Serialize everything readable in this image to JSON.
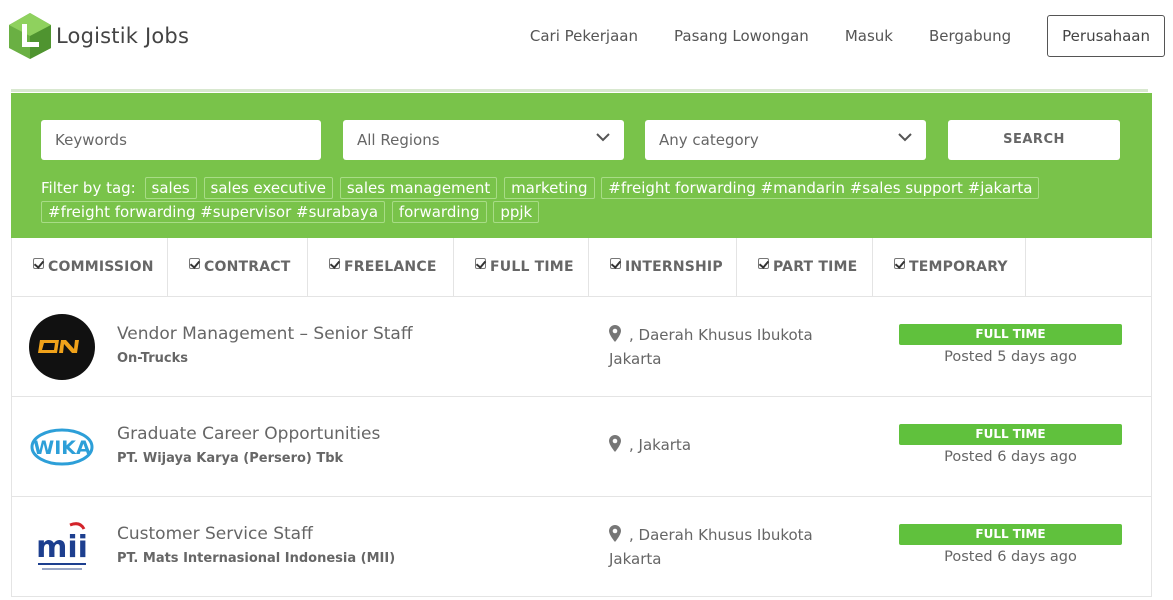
{
  "brand": {
    "name": "Logistik Jobs",
    "color": "#79c34a"
  },
  "nav": {
    "items": [
      "Cari Pekerjaan",
      "Pasang Lowongan",
      "Masuk",
      "Bergabung"
    ],
    "company_button": "Perusahaan"
  },
  "search": {
    "keywords_placeholder": "Keywords",
    "region_value": "All Regions",
    "category_value": "Any category",
    "search_label": "SEARCH",
    "filter_label": "Filter by tag:",
    "tags": [
      "sales",
      "sales executive",
      "sales management",
      "marketing",
      "#freight forwarding #mandarin #sales support #jakarta",
      "#freight forwarding #supervisor #surabaya",
      "forwarding",
      "ppjk"
    ]
  },
  "job_types": [
    "COMMISSION",
    "CONTRACT",
    "FREELANCE",
    "FULL TIME",
    "INTERNSHIP",
    "PART TIME",
    "TEMPORARY"
  ],
  "jobs": [
    {
      "title": "Vendor Management – Senior Staff",
      "company": "On-Trucks",
      "location": ", Daerah Khusus Ibukota Jakarta",
      "type": "FULL TIME",
      "posted": "Posted 5 days ago",
      "logo_icon": "on-trucks-logo"
    },
    {
      "title": "Graduate Career Opportunities",
      "company": "PT. Wijaya Karya (Persero) Tbk",
      "location": ", Jakarta",
      "type": "FULL TIME",
      "posted": "Posted 6 days ago",
      "logo_icon": "wika-logo"
    },
    {
      "title": "Customer Service Staff",
      "company": "PT. Mats Internasional Indonesia (MII)",
      "location": ", Daerah Khusus Ibukota Jakarta",
      "type": "FULL TIME",
      "posted": "Posted 6 days ago",
      "logo_icon": "mii-logo"
    }
  ]
}
